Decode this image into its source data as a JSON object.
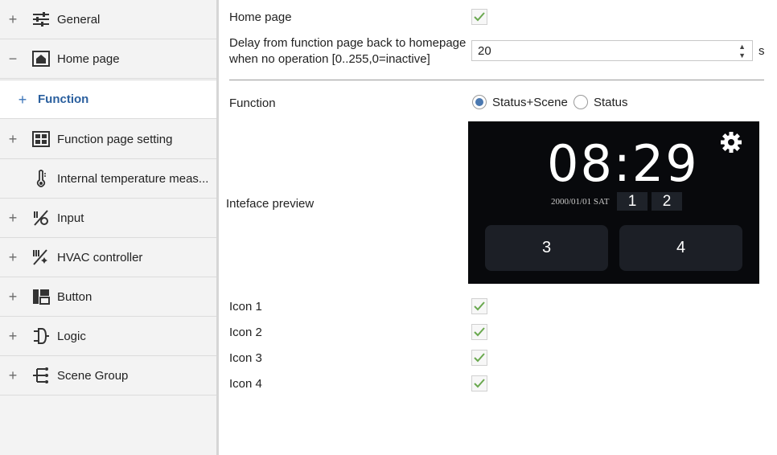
{
  "sidebar": {
    "items": [
      {
        "toggle": "+",
        "icon": "sliders-icon",
        "label": "General"
      },
      {
        "toggle": "−",
        "icon": "home-icon",
        "label": "Home page"
      },
      {
        "toggle": "+",
        "icon": "",
        "label": "Function"
      },
      {
        "toggle": "+",
        "icon": "grid-icon",
        "label": "Function page setting"
      },
      {
        "toggle": "",
        "icon": "thermometer-icon",
        "label": "Internal temperature meas..."
      },
      {
        "toggle": "+",
        "icon": "input-icon",
        "label": "Input"
      },
      {
        "toggle": "+",
        "icon": "hvac-icon",
        "label": "HVAC controller"
      },
      {
        "toggle": "+",
        "icon": "button-icon",
        "label": "Button"
      },
      {
        "toggle": "+",
        "icon": "logic-icon",
        "label": "Logic"
      },
      {
        "toggle": "+",
        "icon": "scene-group-icon",
        "label": "Scene Group"
      }
    ]
  },
  "main": {
    "home_page": {
      "label": "Home page",
      "checked": true
    },
    "delay": {
      "label_line1": "Delay from function page back to homepage",
      "label_line2": "when no operation [0..255,0=inactive]",
      "value": "20",
      "unit": "s"
    },
    "function": {
      "label": "Function",
      "options": [
        {
          "label": "Status+Scene",
          "selected": true
        },
        {
          "label": "Status",
          "selected": false
        }
      ]
    },
    "preview": {
      "label": "Inteface preview",
      "clock": "08:29",
      "date": "2000/01/01  SAT",
      "mini_buttons": [
        "1",
        "2"
      ],
      "big_buttons": [
        "3",
        "4"
      ]
    },
    "icons": [
      {
        "label": "Icon 1",
        "checked": true
      },
      {
        "label": "Icon 2",
        "checked": true
      },
      {
        "label": "Icon 3",
        "checked": true
      },
      {
        "label": "Icon 4",
        "checked": true
      }
    ]
  },
  "colors": {
    "accent": "#2a5f9e",
    "check": "#6aa84f",
    "preview_bg": "#08090c"
  }
}
